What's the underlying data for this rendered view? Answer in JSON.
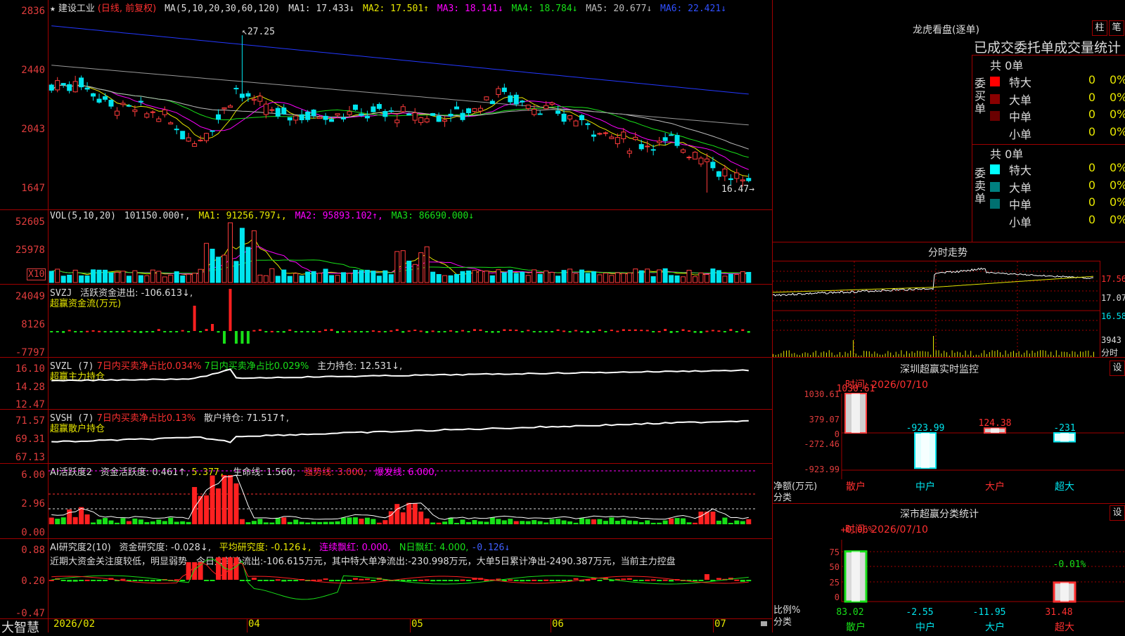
{
  "header": {
    "star": "★",
    "stock_name": "建设工业",
    "period": "(日线, 前复权)",
    "ma_params": "MA(5,10,20,30,60,120)",
    "ma": [
      {
        "label": "MA1: 17.433↓",
        "color": "#dddddd"
      },
      {
        "label": "MA2: 17.501↑",
        "color": "#e6e600"
      },
      {
        "label": "MA3: 18.141↓",
        "color": "#ff00ff"
      },
      {
        "label": "MA4: 18.784↓",
        "color": "#18e018"
      },
      {
        "label": "MA5: 20.677↓",
        "color": "#bbbbbb"
      },
      {
        "label": "MA6: 22.421↓",
        "color": "#3050ff"
      }
    ]
  },
  "price_panel": {
    "y_labels": [
      "2836",
      "2440",
      "2043",
      "1647"
    ],
    "high_label": "27.25",
    "low_label": "16.47",
    "ma_colors": [
      "#e6e600",
      "#ff00ff",
      "#18e018",
      "#bbbbbb",
      "#2438ff"
    ]
  },
  "vol_panel": {
    "title": "VOL(5,10,20)",
    "value": "101150.000↑,",
    "ma1": "MA1: 91256.797↓,",
    "ma2": "MA2: 95893.102↑,",
    "ma3": "MA3: 86690.000↓",
    "y_labels": [
      "52605",
      "25978"
    ],
    "unit": "X10"
  },
  "svzj_panel": {
    "title": "SVZJ",
    "label1": "活跃资金进出: -106.613↓,",
    "label2": "超赢资金流(万元)",
    "y_labels": [
      "24049",
      "8126",
      "-7797"
    ]
  },
  "svzl_panel": {
    "title": "SVZL (7)",
    "r1": "7日内买卖净占比0.034%",
    "r2": "7日内买卖净占比0.029%",
    "r3": "主力持仓: 12.531↓,",
    "label2": "超赢主力持仓",
    "y_labels": [
      "16.10",
      "14.28",
      "12.47"
    ]
  },
  "svsh_panel": {
    "title": "SVSH (7)",
    "r1": "7日内买卖净占比0.13%",
    "r2": "散户持仓: 71.517↑,",
    "label2": "超赢散户持仓",
    "y_labels": [
      "71.57",
      "69.31",
      "67.13"
    ]
  },
  "ai_active_panel": {
    "title": "AI活跃度2",
    "v1": "资金活跃度: 0.461↑,",
    "v2": "5.377,",
    "v3": "生命线: 1.560,",
    "v4": "强势线: 3.000,",
    "v5": "爆发线: 6.000,",
    "y_labels": [
      "6.00",
      "2.96",
      "0.00"
    ]
  },
  "ai_research_panel": {
    "title": "AI研究度2(10)",
    "v1": "资金研究度: -0.028↓,",
    "v2": "平均研究度: -0.126↓,",
    "v3": "连续飘红: 0.000,",
    "v4": "N日飘红: 4.000,",
    "v5": "-0.126↓",
    "commentary": "近期大资金关注度较低，明显弱势，今日大单净流出:-106.615万元，其中特大单净流出:-230.998万元，大单5日累计净出-2490.387万元，当前主力控盘",
    "y_labels": [
      "0.88",
      "0.20",
      "-0.47"
    ]
  },
  "x_axis": {
    "logo": "大智慧",
    "ticks": [
      "2026/02",
      "04",
      "05",
      "06",
      "07"
    ]
  },
  "longhu": {
    "title": "龙虎看盘(逐单)",
    "btn1": "柱",
    "btn2": "笔",
    "subtitle": "已成交委托单成交量统计",
    "buy_header": "共 0单",
    "buy_side": "委买单",
    "sell_header": "共 0单",
    "sell_side": "委卖单",
    "buy_rows": [
      {
        "label": "特大",
        "count": "0",
        "pct": "0%",
        "color": "#ff0000"
      },
      {
        "label": "大单",
        "count": "0",
        "pct": "0%",
        "color": "#8a0000"
      },
      {
        "label": "中单",
        "count": "0",
        "pct": "0%",
        "color": "#6a0000"
      },
      {
        "label": "小单",
        "count": "0",
        "pct": "0%",
        "color": "#000000"
      }
    ],
    "sell_rows": [
      {
        "label": "特大",
        "count": "0",
        "pct": "0%",
        "color": "#00ffff"
      },
      {
        "label": "大单",
        "count": "0",
        "pct": "0%",
        "color": "#008080"
      },
      {
        "label": "中单",
        "count": "0",
        "pct": "0%",
        "color": "#007070"
      },
      {
        "label": "小单",
        "count": "0",
        "pct": "0%",
        "color": "#000000"
      }
    ]
  },
  "intraday": {
    "title": "分时走势",
    "y_labels": [
      "17.56",
      "17.07",
      "16.58"
    ],
    "vol_label": "3943",
    "vol_unit": "分时"
  },
  "monitor": {
    "title": "深圳超赢实时监控",
    "btn": "设",
    "time": "时间: 2026/07/10",
    "y_labels": [
      "1030.61",
      "379.07",
      "0",
      "-272.46",
      "-923.99"
    ],
    "y_unit": "净额(万元)",
    "x_unit": "分类",
    "bars": [
      {
        "name": "散户",
        "value": 1030.61,
        "label": "1030.61"
      },
      {
        "name": "中户",
        "value": -923.99,
        "label": "-923.99"
      },
      {
        "name": "大户",
        "value": 124.38,
        "label": "124.38"
      },
      {
        "name": "超大",
        "value": -231,
        "label": "-231"
      }
    ]
  },
  "classify": {
    "title": "深市超赢分类统计",
    "btn": "设",
    "time": "时间: 2026/07/10",
    "y_labels": [
      "75",
      "50",
      "25",
      "0"
    ],
    "y_unit": "比例%",
    "x_unit": "分类",
    "top_labels": [
      {
        "text": "+0.06%"
      },
      {
        "text": "-0.01%"
      }
    ],
    "bars": [
      {
        "name": "散户",
        "value": 83.02,
        "label": "83.02"
      },
      {
        "name": "中户",
        "value": -2.55,
        "label": "-2.55"
      },
      {
        "name": "大户",
        "value": -11.95,
        "label": "-11.95"
      },
      {
        "name": "超大",
        "value": 31.48,
        "label": "31.48"
      }
    ]
  }
}
